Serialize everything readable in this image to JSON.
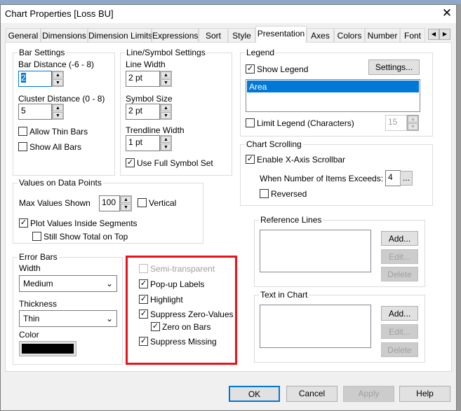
{
  "window": {
    "title": "Chart Properties [Loss BU]",
    "close_icon": "close-icon"
  },
  "tabs": [
    "General",
    "Dimensions",
    "Dimension Limits",
    "Expressions",
    "Sort",
    "Style",
    "Presentation",
    "Axes",
    "Colors",
    "Number",
    "Font"
  ],
  "selected_tab": "Presentation",
  "bar_settings": {
    "title": "Bar Settings",
    "bar_distance_label": "Bar Distance (-6 - 8)",
    "bar_distance": "2",
    "cluster_distance_label": "Cluster Distance (0 - 8)",
    "cluster_distance": "5",
    "allow_thin_bars": "Allow Thin Bars",
    "show_all_bars": "Show All Bars"
  },
  "line_symbol": {
    "title": "Line/Symbol Settings",
    "line_width_label": "Line Width",
    "line_width": "2 pt",
    "symbol_size_label": "Symbol Size",
    "symbol_size": "2 pt",
    "trendline_width_label": "Trendline Width",
    "trendline_width": "1 pt",
    "use_full_symbol_set": "Use Full Symbol Set",
    "check": "✓"
  },
  "values_on_data_points": {
    "title": "Values on Data Points",
    "max_values_label": "Max Values Shown",
    "max_values": "100",
    "vertical": "Vertical",
    "plot_inside": "Plot Values Inside Segments",
    "still_show_total": "Still Show Total on Top"
  },
  "error_bars": {
    "title": "Error Bars",
    "width_label": "Width",
    "width": "Medium",
    "thickness_label": "Thickness",
    "thickness": "Thin",
    "color_label": "Color",
    "color": "#000000"
  },
  "options": {
    "semi_transparent": "Semi-transparent",
    "popup_labels": "Pop-up Labels",
    "highlight": "Highlight",
    "suppress_zero": "Suppress Zero-Values",
    "zero_on_bars": "Zero on Bars",
    "suppress_missing": "Suppress Missing",
    "highlight_color": "#e8141b"
  },
  "legend": {
    "title": "Legend",
    "show_legend": "Show Legend",
    "settings": "Settings...",
    "items": [
      "Area"
    ],
    "limit_legend": "Limit Legend (Characters)",
    "limit_value": "15"
  },
  "chart_scrolling": {
    "title": "Chart Scrolling",
    "enable": "Enable X-Axis Scrollbar",
    "when_exceeds": "When Number of Items Exceeds:",
    "exceeds_value": "4",
    "browse": "...",
    "reversed": "Reversed"
  },
  "reference_lines": {
    "title": "Reference Lines",
    "add": "Add...",
    "edit": "Edit...",
    "delete": "Delete"
  },
  "text_in_chart": {
    "title": "Text in Chart",
    "add": "Add...",
    "edit": "Edit...",
    "delete": "Delete"
  },
  "footer": {
    "ok": "OK",
    "cancel": "Cancel",
    "apply": "Apply",
    "help": "Help"
  }
}
